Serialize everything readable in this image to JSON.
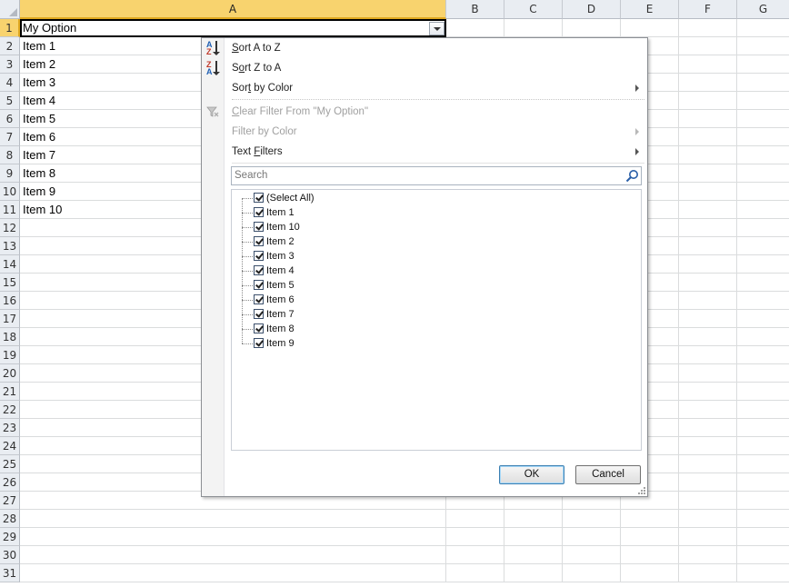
{
  "sheet": {
    "columns": [
      "A",
      "B",
      "C",
      "D",
      "E",
      "F",
      "G"
    ],
    "rows": [
      "1",
      "2",
      "3",
      "4",
      "5",
      "6",
      "7",
      "8",
      "9",
      "10",
      "11",
      "12",
      "13",
      "14",
      "15",
      "16",
      "17",
      "18",
      "19",
      "20",
      "21",
      "22",
      "23",
      "24",
      "25",
      "26",
      "27",
      "28",
      "29",
      "30",
      "31"
    ],
    "cells_a": [
      "My Option",
      "Item 1",
      "Item 2",
      "Item 3",
      "Item 4",
      "Item 5",
      "Item 6",
      "Item 7",
      "Item 8",
      "Item 9",
      "Item 10"
    ],
    "selected_column": "A",
    "selected_row": "1"
  },
  "filter_menu": {
    "sort_az": {
      "pre": "",
      "key": "S",
      "post": "ort A to Z"
    },
    "sort_za": {
      "pre": "S",
      "key": "o",
      "post": "rt Z to A"
    },
    "sort_by_color": {
      "pre": "Sor",
      "key": "t",
      "post": " by Color"
    },
    "clear_filter": {
      "pre": "",
      "key": "C",
      "post": "lear Filter From \"My Option\"",
      "disabled": true
    },
    "filter_by_color": {
      "pre": "",
      "key": "",
      "post": "Filter by Color",
      "disabled": true
    },
    "text_filters": {
      "pre": "Text ",
      "key": "F",
      "post": "ilters"
    },
    "sort_icons": {
      "az_top": "A",
      "az_bottom": "Z",
      "za_top": "Z",
      "za_bottom": "A"
    },
    "search_placeholder": "Search",
    "list_items": [
      "(Select All)",
      "Item 1",
      "Item 10",
      "Item 2",
      "Item 3",
      "Item 4",
      "Item 5",
      "Item 6",
      "Item 7",
      "Item 8",
      "Item 9"
    ],
    "ok_label": "OK",
    "cancel_label": "Cancel"
  },
  "colors": {
    "selected_header": "#f8d36e",
    "header_bg": "#e9edf2",
    "ok_border": "#3c7fb1"
  }
}
